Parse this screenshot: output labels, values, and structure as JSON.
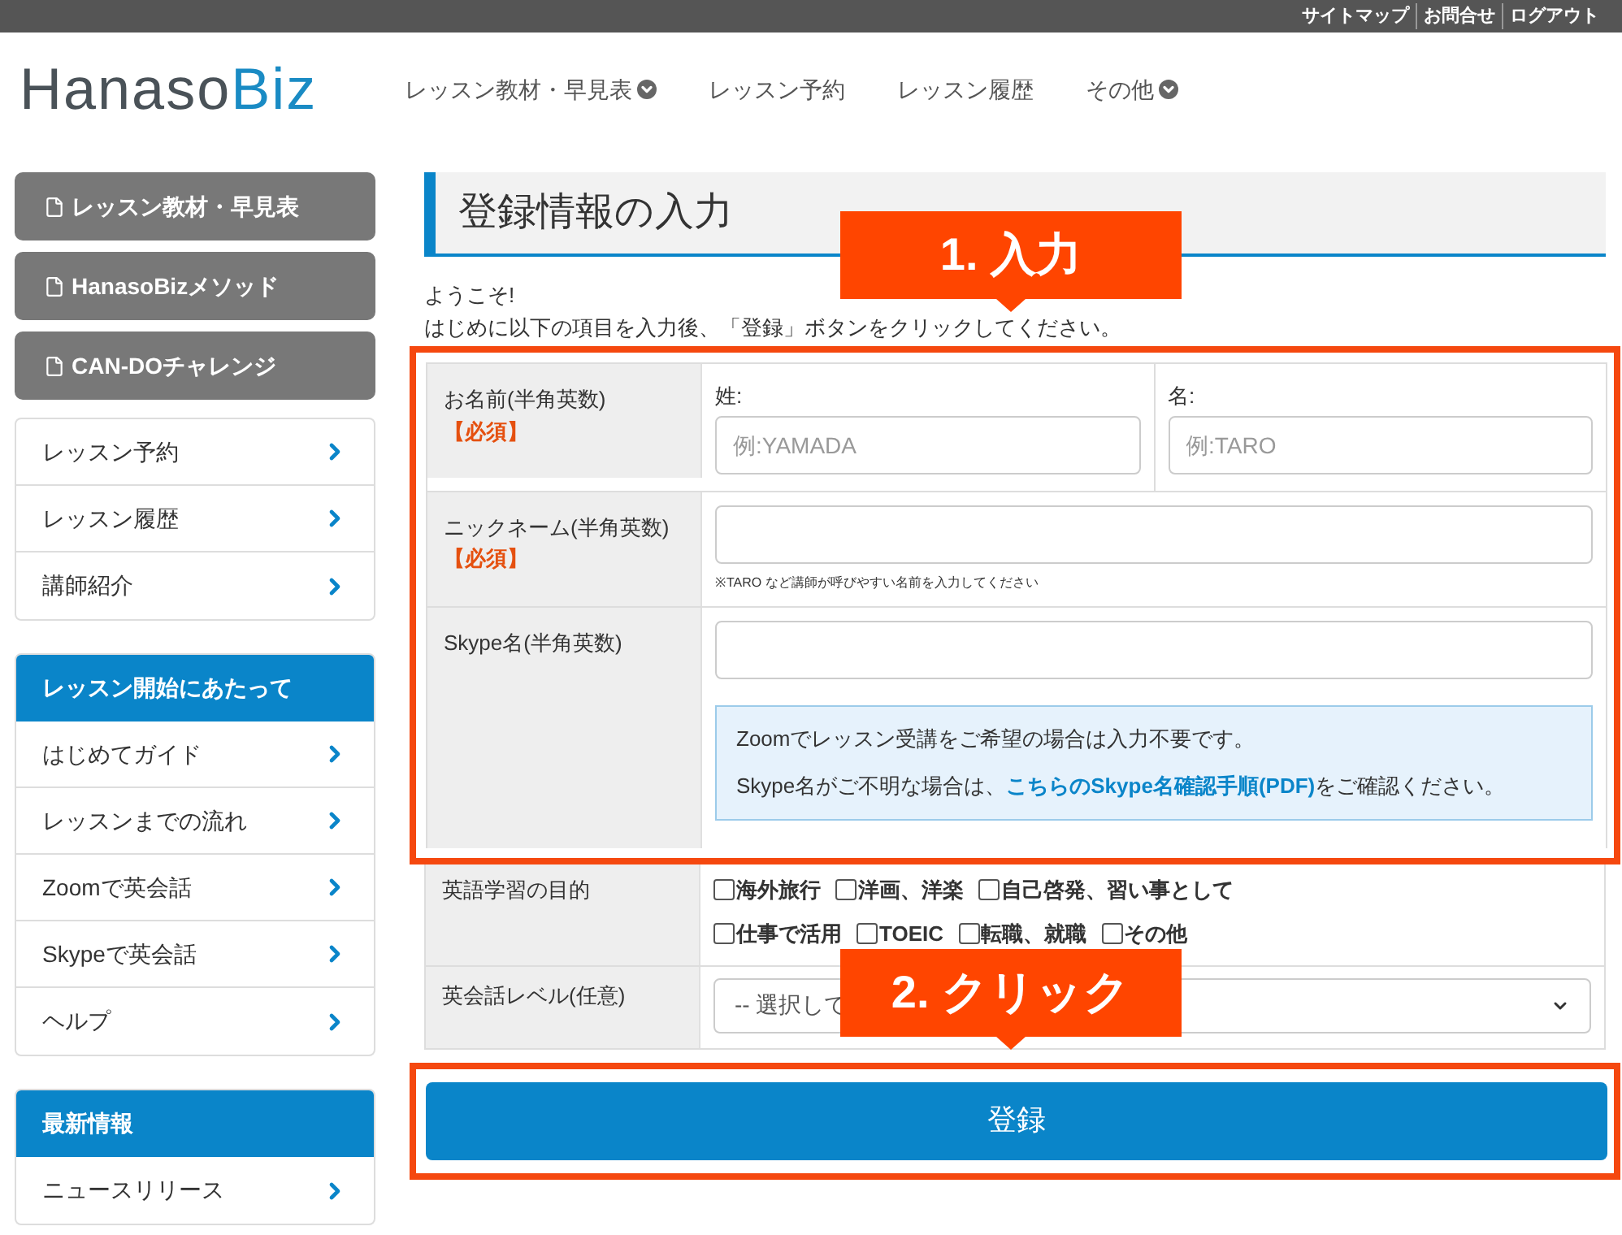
{
  "top_links": [
    "サイトマップ",
    "お問合せ",
    "ログアウト"
  ],
  "logo": {
    "part_1": "Hanaso",
    "part_2": "Biz"
  },
  "nav": [
    {
      "label": "レッスン教材・早見表",
      "dropdown": true
    },
    {
      "label": "レッスン予約",
      "dropdown": false
    },
    {
      "label": "レッスン履歴",
      "dropdown": false
    },
    {
      "label": "その他",
      "dropdown": true
    }
  ],
  "sidebar": {
    "buttons": [
      "レッスン教材・早見表",
      "HanasoBizメソッド",
      "CAN-DOチャレンジ"
    ],
    "menu": [
      "レッスン予約",
      "レッスン履歴",
      "講師紹介"
    ],
    "sections": [
      {
        "title": "レッスン開始にあたって",
        "items": [
          "はじめてガイド",
          "レッスンまでの流れ",
          "Zoomで英会話",
          "Skypeで英会話",
          "ヘルプ"
        ]
      },
      {
        "title": "最新情報",
        "items": [
          "ニュースリリース"
        ]
      }
    ]
  },
  "form": {
    "title": "登録情報の入力",
    "greeting": "ようこそ!",
    "instruction": "はじめに以下の項目を入力後、「登録」ボタンをクリックしてください。",
    "name_row": {
      "label": "お名前(半角英数)",
      "required": "【必須】",
      "last_label": "姓:",
      "last_placeholder": "例:YAMADA",
      "first_label": "名:",
      "first_placeholder": "例:TARO"
    },
    "nickname_row": {
      "label": "ニックネーム(半角英数)",
      "required": "【必須】",
      "note": "※TARO など講師が呼びやすい名前を入力してください"
    },
    "skype_row": {
      "label": "Skype名(半角英数)",
      "info_1": "Zoomでレッスン受講をご希望の場合は入力不要です。",
      "info_2_before": "Skype名がご不明な場合は、",
      "info_2_link": "こちらのSkype名確認手順(PDF)",
      "info_2_after": "をご確認ください。"
    },
    "purpose_row": {
      "label": "英語学習の目的",
      "options": [
        {
          "label": "海外旅行",
          "checked": false
        },
        {
          "label": "洋画、洋楽",
          "checked": false
        },
        {
          "label": "自己啓発、習い事として",
          "checked": false
        },
        {
          "label": "仕事で活用",
          "checked": false
        },
        {
          "label": "TOEIC",
          "checked": false
        },
        {
          "label": "転職、就職",
          "checked": false
        },
        {
          "label": "その他",
          "checked": false
        }
      ]
    },
    "level_row": {
      "label": "英会話レベル(任意)",
      "value": "-- 選択して"
    },
    "submit": "登録"
  },
  "callouts": [
    "1. 入力",
    "2. クリック"
  ]
}
